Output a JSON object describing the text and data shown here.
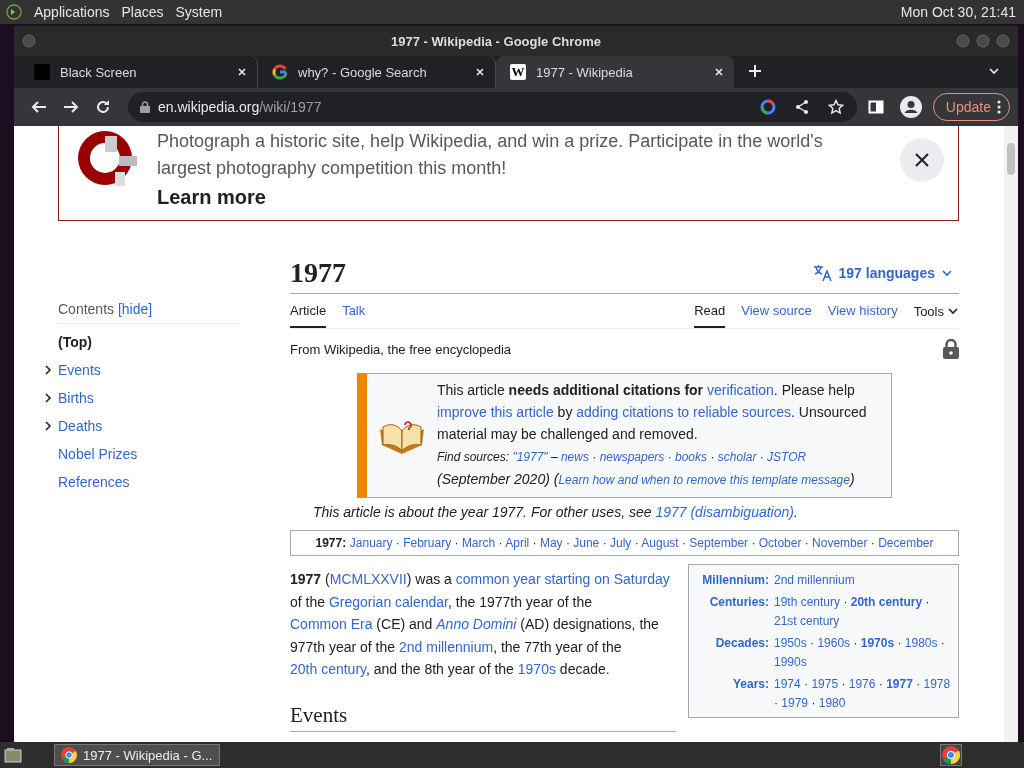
{
  "top_panel": {
    "menus": [
      "Applications",
      "Places",
      "System"
    ],
    "clock": "Mon Oct 30, 21:41"
  },
  "window": {
    "title": "1977 - Wikipedia - Google Chrome"
  },
  "tabs": [
    {
      "title": "Black Screen",
      "selected": false,
      "kind": "black"
    },
    {
      "title": "why? - Google Search",
      "selected": false,
      "kind": "ring"
    },
    {
      "title": "1977 - Wikipedia",
      "selected": true,
      "kind": "letter",
      "favicon_letter": "W"
    }
  ],
  "address": {
    "host": "en.wikipedia.org",
    "path": "/wiki/1977"
  },
  "update_button": "Update",
  "banner": {
    "text": "Photograph a historic site, help Wikipedia, and win a prize. Participate in the world's largest photography competition this month!",
    "link": "Learn more"
  },
  "article": {
    "title": "1977",
    "languages": "197 languages",
    "left_tabs": [
      {
        "label": "Article",
        "selected": true
      },
      {
        "label": "Talk",
        "selected": false
      }
    ],
    "right_tabs": [
      {
        "label": "Read",
        "selected": true
      },
      {
        "label": "View source",
        "selected": false
      },
      {
        "label": "View history",
        "selected": false
      }
    ],
    "tools": "Tools",
    "tagline": "From Wikipedia, the free encyclopedia"
  },
  "toc": {
    "heading": "Contents",
    "toggle": "[hide]",
    "items": [
      {
        "label": "(Top)",
        "selected": true,
        "collapsed": false
      },
      {
        "label": "Events",
        "selected": false,
        "collapsed": true
      },
      {
        "label": "Births",
        "selected": false,
        "collapsed": true
      },
      {
        "label": "Deaths",
        "selected": false,
        "collapsed": true
      },
      {
        "label": "Nobel Prizes",
        "selected": false,
        "collapsed": false
      },
      {
        "label": "References",
        "selected": false,
        "collapsed": false
      }
    ]
  },
  "ambox": {
    "message": [
      {
        "kind": "text",
        "text": "This article "
      },
      {
        "kind": "bold",
        "text": "needs additional citations for "
      },
      {
        "kind": "link",
        "text": "verification"
      },
      {
        "kind": "text",
        "text": ". Please help "
      },
      {
        "kind": "link",
        "text": "improve this article"
      },
      {
        "kind": "text",
        "text": " by "
      },
      {
        "kind": "link",
        "text": "adding citations to reliable sources"
      },
      {
        "kind": "text",
        "text": ". Unsourced material may be challenged and removed."
      }
    ],
    "sources": [
      {
        "kind": "small-italic",
        "text": "Find sources: "
      },
      {
        "kind": "small-link",
        "text": "\"1977\""
      },
      {
        "kind": "small-italic",
        "text": " – "
      },
      {
        "kind": "small-link",
        "text": "news"
      },
      {
        "kind": "small-italic",
        "text": " · "
      },
      {
        "kind": "small-link",
        "text": "newspapers"
      },
      {
        "kind": "small-italic",
        "text": " · "
      },
      {
        "kind": "small-link",
        "text": "books"
      },
      {
        "kind": "small-italic",
        "text": " · "
      },
      {
        "kind": "small-link",
        "text": "scholar"
      },
      {
        "kind": "small-italic",
        "text": " · "
      },
      {
        "kind": "small-link",
        "text": "JSTOR"
      },
      {
        "kind": "italic",
        "text": " (September 2020) ("
      },
      {
        "kind": "small-link",
        "text": "Learn how and when to remove this template message"
      },
      {
        "kind": "italic",
        "text": ")"
      }
    ]
  },
  "hatnote": [
    {
      "kind": "text",
      "text": "This article is about the year 1977. For other uses, see "
    },
    {
      "kind": "link",
      "text": "1977 (disambiguation)"
    },
    {
      "kind": "text",
      "text": "."
    }
  ],
  "navbox": [
    {
      "kind": "bold",
      "text": "1977:"
    },
    {
      "kind": "link",
      "text": "January"
    },
    {
      "kind": "text",
      "text": " · "
    },
    {
      "kind": "link",
      "text": "February"
    },
    {
      "kind": "text",
      "text": " · "
    },
    {
      "kind": "link",
      "text": "March"
    },
    {
      "kind": "text",
      "text": " · "
    },
    {
      "kind": "link",
      "text": "April"
    },
    {
      "kind": "text",
      "text": " · "
    },
    {
      "kind": "link",
      "text": "May"
    },
    {
      "kind": "text",
      "text": " · "
    },
    {
      "kind": "link",
      "text": "June"
    },
    {
      "kind": "text",
      "text": " · "
    },
    {
      "kind": "link",
      "text": "July"
    },
    {
      "kind": "text",
      "text": " · "
    },
    {
      "kind": "link",
      "text": "August"
    },
    {
      "kind": "text",
      "text": " · "
    },
    {
      "kind": "link",
      "text": "September"
    },
    {
      "kind": "text",
      "text": " · "
    },
    {
      "kind": "link",
      "text": "October"
    },
    {
      "kind": "text",
      "text": " · "
    },
    {
      "kind": "link",
      "text": "November"
    },
    {
      "kind": "text",
      "text": " · "
    },
    {
      "kind": "link",
      "text": "December"
    }
  ],
  "lead": [
    {
      "kind": "bold",
      "text": "1977"
    },
    {
      "kind": "text",
      "text": " ("
    },
    {
      "kind": "link",
      "text": "MCMLXXVII"
    },
    {
      "kind": "text",
      "text": ") was a "
    },
    {
      "kind": "link",
      "text": "common year starting on Saturday"
    },
    {
      "kind": "text",
      "text": " of the "
    },
    {
      "kind": "link",
      "text": "Gregorian calendar"
    },
    {
      "kind": "text",
      "text": ", the 1977th year of the "
    },
    {
      "kind": "link",
      "text": "Common Era"
    },
    {
      "kind": "text",
      "text": " (CE) and "
    },
    {
      "kind": "italic-link",
      "text": "Anno Domini"
    },
    {
      "kind": "text",
      "text": " (AD) designations, the 977th year of the "
    },
    {
      "kind": "link",
      "text": "2nd millennium"
    },
    {
      "kind": "text",
      "text": ", the 77th year of the "
    },
    {
      "kind": "link",
      "text": "20th century"
    },
    {
      "kind": "text",
      "text": ", and the 8th year of the "
    },
    {
      "kind": "link",
      "text": "1970s"
    },
    {
      "kind": "text",
      "text": " decade."
    }
  ],
  "infobox": [
    {
      "label": "Millennium:",
      "value": [
        {
          "kind": "link",
          "text": "2nd millennium"
        }
      ]
    },
    {
      "label": "Centuries:",
      "value": [
        {
          "kind": "link",
          "text": "19th century"
        },
        {
          "kind": "text",
          "text": " · "
        },
        {
          "kind": "bold-link",
          "text": "20th century"
        },
        {
          "kind": "text",
          "text": " · "
        },
        {
          "kind": "link",
          "text": "21st century"
        }
      ]
    },
    {
      "label": "Decades:",
      "value": [
        {
          "kind": "link",
          "text": "1950s"
        },
        {
          "kind": "text",
          "text": " · "
        },
        {
          "kind": "link",
          "text": "1960s"
        },
        {
          "kind": "text",
          "text": " · "
        },
        {
          "kind": "bold-link",
          "text": "1970s"
        },
        {
          "kind": "text",
          "text": " · "
        },
        {
          "kind": "link",
          "text": "1980s"
        },
        {
          "kind": "text",
          "text": " · "
        },
        {
          "kind": "link",
          "text": "1990s"
        }
      ]
    },
    {
      "label": "Years:",
      "value": [
        {
          "kind": "link",
          "text": "1974"
        },
        {
          "kind": "text",
          "text": " · "
        },
        {
          "kind": "link",
          "text": "1975"
        },
        {
          "kind": "text",
          "text": " · "
        },
        {
          "kind": "link",
          "text": "1976"
        },
        {
          "kind": "text",
          "text": " · "
        },
        {
          "kind": "bold-link",
          "text": "1977"
        },
        {
          "kind": "text",
          "text": " · "
        },
        {
          "kind": "link",
          "text": "1978"
        },
        {
          "kind": "text",
          "text": " · "
        },
        {
          "kind": "link",
          "text": "1979"
        },
        {
          "kind": "text",
          "text": " · "
        },
        {
          "kind": "link",
          "text": "1980"
        }
      ]
    }
  ],
  "section_heading": "Events",
  "taskbar": {
    "tasks": [
      {
        "title": "1977 - Wikipedia - G...",
        "selected": true
      }
    ]
  }
}
